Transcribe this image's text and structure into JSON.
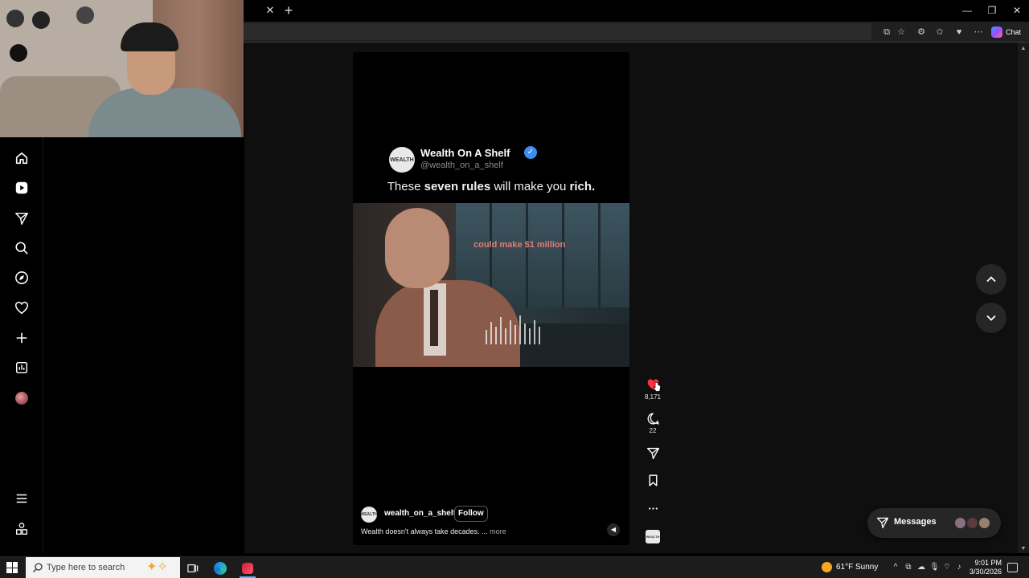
{
  "browser": {
    "tab_close_label": "✕",
    "tab_new_label": "+",
    "window_minimize": "—",
    "window_restore": "❐",
    "window_close": "✕",
    "copilot_label": "Chat",
    "toolbar_icons": [
      "split-screen-icon",
      "favorite-star-icon",
      "extensions-icon",
      "favorites-icon",
      "browser-essentials-icon",
      "more-icon"
    ]
  },
  "left_nav": {
    "items": [
      {
        "icon": "home-icon"
      },
      {
        "icon": "reels-icon"
      },
      {
        "icon": "send-icon"
      },
      {
        "icon": "search-icon"
      },
      {
        "icon": "explore-icon"
      },
      {
        "icon": "heart-icon"
      },
      {
        "icon": "create-icon"
      },
      {
        "icon": "dashboard-icon"
      },
      {
        "icon": "profile-avatar"
      }
    ],
    "bottom": [
      {
        "icon": "menu-icon"
      },
      {
        "icon": "more-apps-icon"
      }
    ]
  },
  "reel": {
    "account_name": "Wealth On A Shelf",
    "account_handle": "@wealth_on_a_shelf",
    "avatar_text": "WEALTH",
    "headline_pre": "These ",
    "headline_bold1": "seven rules",
    "headline_mid": " will make you ",
    "headline_bold2": "rich.",
    "image_caption": "could make $1 million",
    "footer_username": "wealth_on_a_shelf",
    "follow_label": "Follow",
    "caption_text": "Wealth doesn't always take decades. ...",
    "caption_more": "more"
  },
  "actions": {
    "like_count": "8,171",
    "comment_count": "22"
  },
  "messages": {
    "label": "Messages"
  },
  "taskbar": {
    "search_placeholder": "Type here to search",
    "weather": "61°F  Sunny",
    "time": "9:01 PM",
    "date": "3/30/2026"
  },
  "colors": {
    "like_red": "#ff3040",
    "verified_blue": "#3d8ef0",
    "page_bg": "#0f0f10"
  }
}
